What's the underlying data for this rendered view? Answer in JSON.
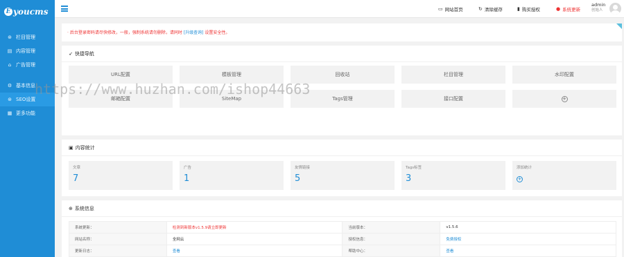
{
  "sidebar": {
    "logo_text": "youcms",
    "logo_mark": "E",
    "items": [
      {
        "icon": "globe-icon",
        "label": "栏目管理"
      },
      {
        "icon": "document-icon",
        "label": "内容管理"
      },
      {
        "icon": "home-icon",
        "label": "广告管理"
      },
      {
        "icon": "gear-icon",
        "label": "基本信息"
      },
      {
        "icon": "globe-icon",
        "label": "SEO设置"
      },
      {
        "icon": "grid-icon",
        "label": "更多功能"
      }
    ]
  },
  "header": {
    "links": [
      {
        "icon": "monitor-icon",
        "label": "网站首页"
      },
      {
        "icon": "refresh-icon",
        "label": "清除缓存"
      },
      {
        "icon": "bookmark-icon",
        "label": "购买授权"
      },
      {
        "icon": "alert-icon",
        "label": "系统更新"
      }
    ],
    "user_name": "admin",
    "user_role": "创始人"
  },
  "notice": {
    "text_before": "· 后台登录密码请尽快修改，一般，强制系统请勿删除，请同时",
    "link_text": "[升级查询]",
    "text_after": "设置安全性。"
  },
  "quick_nav": {
    "title": "快捷导航",
    "buttons": [
      "URL配置",
      "模板管理",
      "回收站",
      "栏目管理",
      "水印配置",
      "邮箱配置",
      "SiteMap",
      "Tags管理",
      "接口配置",
      "+"
    ]
  },
  "content_stats": {
    "title": "内容统计",
    "items": [
      {
        "label": "文章",
        "value": "7"
      },
      {
        "label": "广告",
        "value": "1"
      },
      {
        "label": "友情链接",
        "value": "5"
      },
      {
        "label": "Tags标签",
        "value": "3"
      },
      {
        "label": "添加统计",
        "value": "+"
      }
    ]
  },
  "system_info": {
    "title": "系统信息",
    "rows": [
      {
        "k1": "系统更新：",
        "v1": "检测到新版本v1.5.9请立即更新",
        "k2": "当前版本：",
        "v2": "v1.5.6"
      },
      {
        "k1": "网站名称：",
        "v1": "全网云",
        "k2": "授权信息：",
        "v2": "免费授权"
      },
      {
        "k1": "更新日志：",
        "v1": "查看",
        "k2": "帮助中心：",
        "v2": "查看"
      }
    ]
  },
  "watermark": "https://www.huzhan.com/ishop44663",
  "colors": {
    "accent": "#1f8dd6",
    "warning": "#e33333"
  }
}
